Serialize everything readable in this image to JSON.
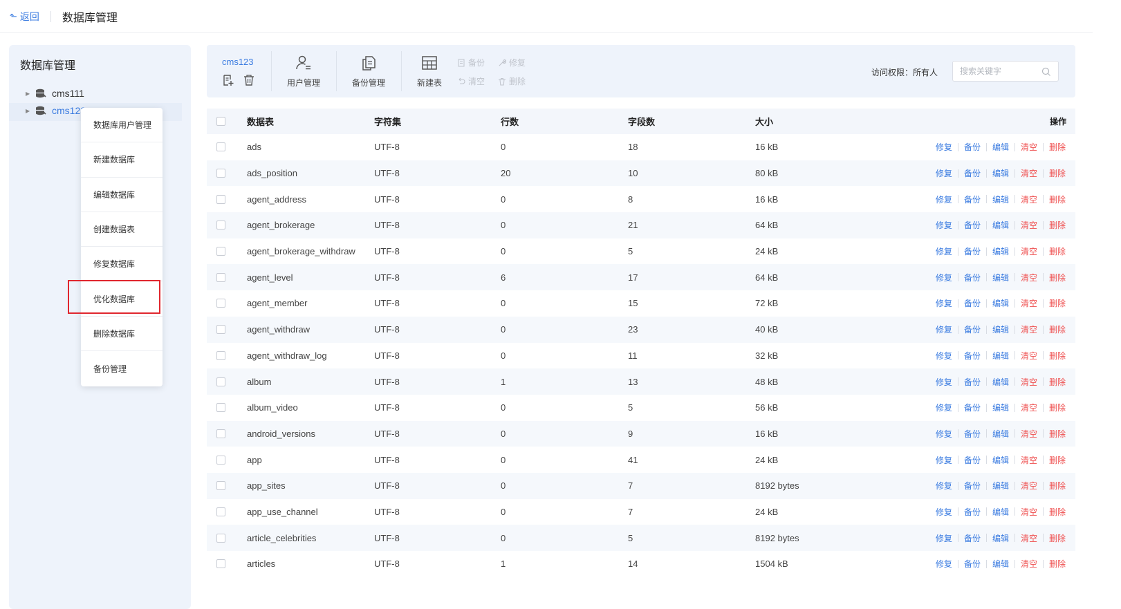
{
  "topbar": {
    "back_label": "返回",
    "title": "数据库管理"
  },
  "sidebar": {
    "title": "数据库管理",
    "databases": [
      {
        "name": "cms111"
      },
      {
        "name": "cms123"
      }
    ]
  },
  "context_menu": {
    "items": [
      "数据库用户管理",
      "新建数据库",
      "编辑数据库",
      "创建数据表",
      "修复数据库",
      "优化数据库",
      "删除数据库",
      "备份管理"
    ]
  },
  "toolbar": {
    "db_name": "cms123",
    "user_mgmt": "用户管理",
    "backup_mgmt": "备份管理",
    "new_table": "新建表",
    "backup": "备份",
    "repair": "修复",
    "clear": "清空",
    "delete": "删除",
    "permission": "访问权限：所有人",
    "search_placeholder": "搜索关键字"
  },
  "table": {
    "headers": {
      "name": "数据表",
      "charset": "字符集",
      "rows": "行数",
      "fields": "字段数",
      "size": "大小",
      "ops": "操作"
    },
    "ops": {
      "repair": "修复",
      "backup": "备份",
      "edit": "编辑",
      "clear": "清空",
      "delete": "删除"
    },
    "rows": [
      {
        "name": "ads",
        "charset": "UTF-8",
        "rows": "0",
        "fields": "18",
        "size": "16 kB"
      },
      {
        "name": "ads_position",
        "charset": "UTF-8",
        "rows": "20",
        "fields": "10",
        "size": "80 kB"
      },
      {
        "name": "agent_address",
        "charset": "UTF-8",
        "rows": "0",
        "fields": "8",
        "size": "16 kB"
      },
      {
        "name": "agent_brokerage",
        "charset": "UTF-8",
        "rows": "0",
        "fields": "21",
        "size": "64 kB"
      },
      {
        "name": "agent_brokerage_withdraw",
        "charset": "UTF-8",
        "rows": "0",
        "fields": "5",
        "size": "24 kB"
      },
      {
        "name": "agent_level",
        "charset": "UTF-8",
        "rows": "6",
        "fields": "17",
        "size": "64 kB"
      },
      {
        "name": "agent_member",
        "charset": "UTF-8",
        "rows": "0",
        "fields": "15",
        "size": "72 kB"
      },
      {
        "name": "agent_withdraw",
        "charset": "UTF-8",
        "rows": "0",
        "fields": "23",
        "size": "40 kB"
      },
      {
        "name": "agent_withdraw_log",
        "charset": "UTF-8",
        "rows": "0",
        "fields": "11",
        "size": "32 kB"
      },
      {
        "name": "album",
        "charset": "UTF-8",
        "rows": "1",
        "fields": "13",
        "size": "48 kB"
      },
      {
        "name": "album_video",
        "charset": "UTF-8",
        "rows": "0",
        "fields": "5",
        "size": "56 kB"
      },
      {
        "name": "android_versions",
        "charset": "UTF-8",
        "rows": "0",
        "fields": "9",
        "size": "16 kB"
      },
      {
        "name": "app",
        "charset": "UTF-8",
        "rows": "0",
        "fields": "41",
        "size": "24 kB"
      },
      {
        "name": "app_sites",
        "charset": "UTF-8",
        "rows": "0",
        "fields": "7",
        "size": "8192 bytes"
      },
      {
        "name": "app_use_channel",
        "charset": "UTF-8",
        "rows": "0",
        "fields": "7",
        "size": "24 kB"
      },
      {
        "name": "article_celebrities",
        "charset": "UTF-8",
        "rows": "0",
        "fields": "5",
        "size": "8192 bytes"
      },
      {
        "name": "articles",
        "charset": "UTF-8",
        "rows": "1",
        "fields": "14",
        "size": "1504 kB"
      }
    ]
  }
}
